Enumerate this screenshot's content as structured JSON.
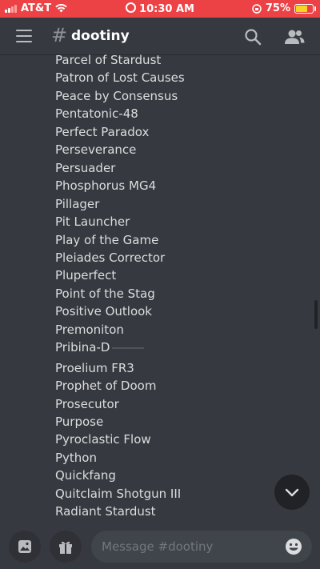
{
  "status_bar": {
    "carrier": "AT&T",
    "time": "10:30 AM",
    "battery_percent": "75%",
    "battery_level": 0.75,
    "icons": [
      "signal-icon",
      "wifi-icon",
      "alarm-icon",
      "rotation-lock-icon",
      "battery-icon"
    ]
  },
  "header": {
    "hash": "#",
    "channel_name": "dootiny",
    "icons": [
      "hamburger-icon",
      "search-icon",
      "members-icon"
    ]
  },
  "list": {
    "items": [
      "Parcel of Stardust",
      "Patron of Lost Causes",
      "Peace by Consensus",
      "Pentatonic-48",
      "Perfect Paradox",
      "Perseverance",
      "Persuader",
      "Phosphorus MG4",
      "Pillager",
      "Pit Launcher",
      "Play of the Game",
      "Pleiades Corrector",
      "Pluperfect",
      "Point of the Stag",
      "Positive Outlook",
      "Premoniton",
      "Pribina-D",
      "Proelium FR3",
      "Prophet of Doom",
      "Prosecutor",
      "Purpose",
      "Pyroclastic Flow",
      "Python",
      "Quickfang",
      "Quitclaim Shotgun III",
      "Radiant Stardust"
    ]
  },
  "composer": {
    "placeholder": "Message #dootiny",
    "icons": [
      "image-icon",
      "gift-icon",
      "emoji-icon",
      "chevron-down-icon"
    ]
  },
  "colors": {
    "status_bar": "#ed4245",
    "background": "#36393f",
    "input": "#40444b",
    "text": "#dcddde"
  }
}
